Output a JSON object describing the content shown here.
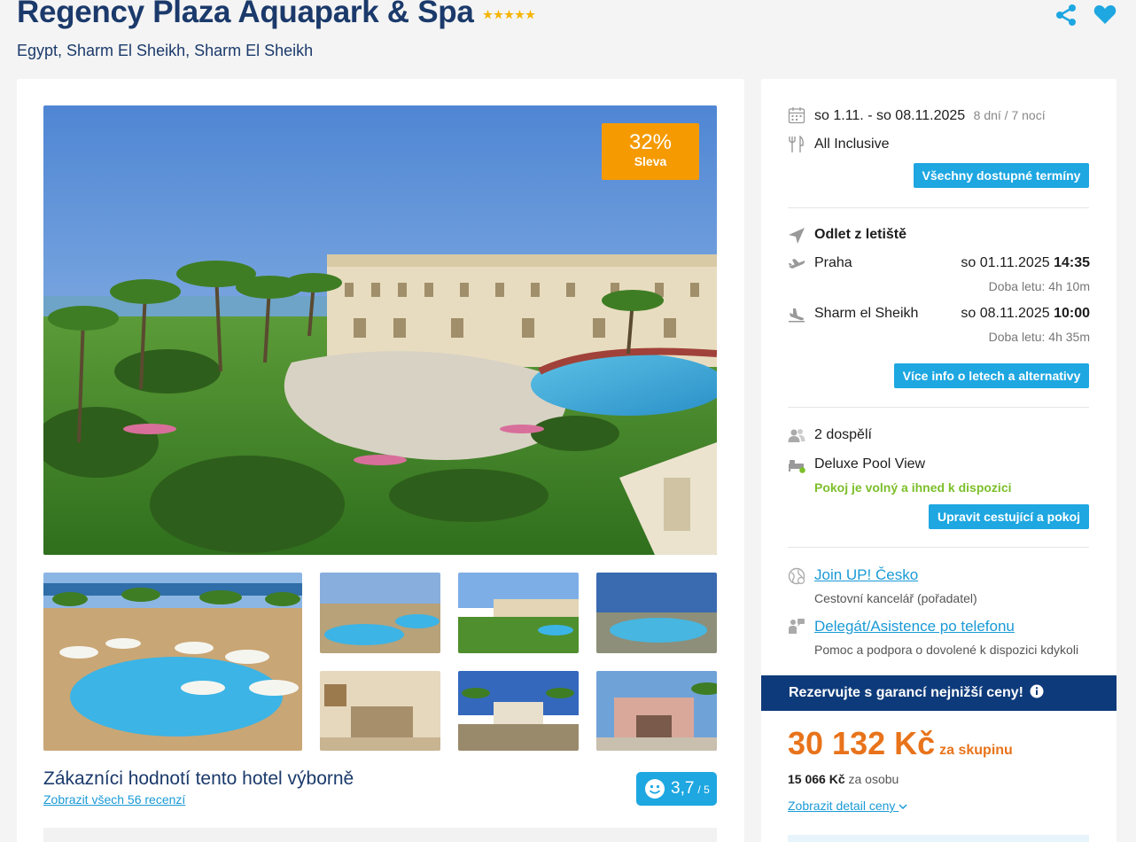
{
  "hotel": {
    "name": "Regency Plaza Aquapark & Spa",
    "stars": 5,
    "location": "Egypt, Sharm El Sheikh, Sharm El Sheikh"
  },
  "gallery": {
    "discount_pct": "32%",
    "discount_label": "Sleva",
    "main_photo": "resort-gardens-pool-photo",
    "thumbnails": [
      "beach-pool-umbrellas",
      "pool-aerial",
      "gardens-buildings",
      "pool-evening",
      "hotel-room",
      "entrance-palms",
      "gate-entrance"
    ]
  },
  "rating": {
    "title": "Zákazníci hodnotí tento hotel výborně",
    "reviews_link": "Zobrazit všech 56 recenzí",
    "score": "3,7",
    "score_max": "/ 5"
  },
  "booking": {
    "dates": "so 1.11. - so 08.11.2025",
    "duration": "8 dní / 7 nocí",
    "board": "All Inclusive",
    "all_dates_btn": "Všechny dostupné termíny",
    "departure_heading": "Odlet z letiště",
    "outbound": {
      "city": "Praha",
      "date": "so 01.11.2025",
      "time": "14:35",
      "flight_time": "Doba letu: 4h 10m"
    },
    "inbound": {
      "city": "Sharm el Sheikh",
      "date": "so 08.11.2025",
      "time": "10:00",
      "flight_time": "Doba letu: 4h 35m"
    },
    "flights_btn": "Více info o letech a alternativy",
    "travelers": "2 dospělí",
    "room": "Deluxe Pool View",
    "room_status": "Pokoj je volný a ihned k dispozici",
    "edit_btn": "Upravit cestující a pokoj",
    "agency_link": "Join UP! Česko",
    "agency_sub": "Cestovní kancelář (pořadatel)",
    "support_link": "Delegát/Asistence po telefonu",
    "support_sub": "Pomoc a podpora o dovolené k dispozici kdykoli",
    "guarantee": "Rezervujte s garancí nejnižší ceny!",
    "price": "30 132 Kč",
    "price_unit": "za skupinu",
    "per_person_amount": "15 066 Kč",
    "per_person_label": "za osobu",
    "detail_link": "Zobrazit detail ceny"
  },
  "colors": {
    "brand": "#1b3a6b",
    "accent": "#1ea7e1",
    "price": "#e8731a",
    "discount": "#f59a00",
    "available": "#7cbf2a"
  }
}
